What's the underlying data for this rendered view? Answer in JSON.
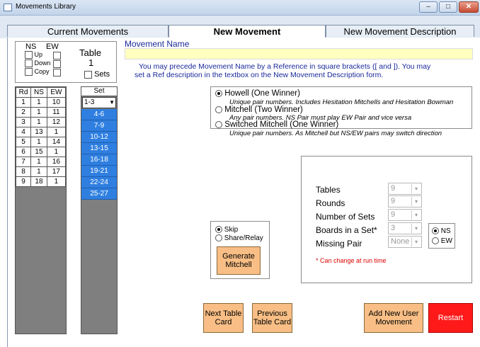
{
  "window": {
    "title": "Movements Library"
  },
  "window_buttons": {
    "minimize": "–",
    "maximize": "□",
    "close": "✕"
  },
  "tabs": [
    "Current Movements",
    "New Movement",
    "New Movement Description"
  ],
  "movement_name": {
    "label": "Movement Name",
    "value": "",
    "hint_line1": "You may precede Movement Name by a Reference in square brackets ([ and ]). You may",
    "hint_line2": "set a Ref description in the textbox on the New Movement Description form."
  },
  "options": {
    "ns_label": "NS",
    "ew_label": "EW",
    "up": "Up",
    "down": "Down",
    "copy": "Copy",
    "table_label": "Table",
    "table_number": "1",
    "sets_label": "Sets"
  },
  "grid": {
    "headers": [
      "Rd",
      "NS",
      "EW"
    ],
    "rows": [
      [
        "1",
        "1",
        "10"
      ],
      [
        "2",
        "1",
        "11"
      ],
      [
        "3",
        "1",
        "12"
      ],
      [
        "4",
        "13",
        "1"
      ],
      [
        "5",
        "1",
        "14"
      ],
      [
        "6",
        "15",
        "1"
      ],
      [
        "7",
        "1",
        "16"
      ],
      [
        "8",
        "1",
        "17"
      ],
      [
        "9",
        "18",
        "1"
      ]
    ]
  },
  "sets": {
    "header": "Set",
    "selected": "1-3",
    "items": [
      "4-6",
      "7-9",
      "10-12",
      "13-15",
      "16-18",
      "19-21",
      "22-24",
      "25-27"
    ]
  },
  "movement_type": [
    {
      "label": "Howell (One Winner)",
      "desc": "Unique pair numbers. Includes Hesitation Mitchells and Hesitation Bowman",
      "selected": true
    },
    {
      "label": "Mitchell (Two Winner)",
      "desc": "Any pair numbers. NS Pair must play EW Pair and vice versa",
      "selected": false
    },
    {
      "label": "Switched Mitchell (One Winner)",
      "desc": "Unique pair numbers. As Mitchell but NS/EW pairs may switch direction",
      "selected": false
    }
  ],
  "params": {
    "tables_label": "Tables",
    "tables_value": "9",
    "rounds_label": "Rounds",
    "rounds_value": "9",
    "sets_label": "Number of Sets",
    "sets_value": "9",
    "boards_label": "Boards in a Set*",
    "boards_value": "3",
    "missing_label": "Missing Pair",
    "missing_value": "None",
    "ns": "NS",
    "ew": "EW",
    "note": "* Can change at run time"
  },
  "skip_panel": {
    "skip": "Skip",
    "share": "Share/Relay",
    "generate": "Generate Mitchell"
  },
  "buttons": {
    "next": "Next Table Card",
    "previous": "Previous Table Card",
    "add": "Add New User Movement",
    "restart": "Restart"
  },
  "colors": {
    "set_blue": "#2f7fe0",
    "button_orange": "#f8be85",
    "restart_red": "#ff1a1a",
    "name_field": "#ffffc0"
  }
}
